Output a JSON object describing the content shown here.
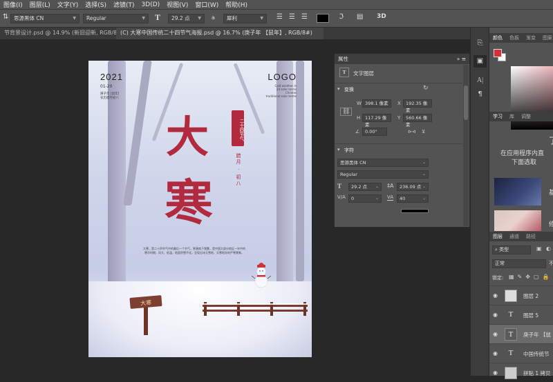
{
  "menubar": {
    "items": [
      "图像(I)",
      "图层(L)",
      "文字(Y)",
      "选择(S)",
      "滤镜(T)",
      "3D(D)",
      "视图(V)",
      "窗口(W)",
      "帮助(H)"
    ]
  },
  "options_bar": {
    "font_family": "思源黑体 CN",
    "font_style": "Regular",
    "font_size": "29.2 点",
    "antialias_label": "a",
    "antialias": "犀利",
    "text_color": "#000000"
  },
  "tabs": [
    {
      "label": "节背景设计.psd @ 14.9% (新旧迎新, RGB/8) *",
      "active": false
    },
    {
      "label": "(C) 大寒中国传统二十四节气海报.psd @ 16.7% (庚子年 【鼠年】, RGB/8#)",
      "active": true
    }
  ],
  "poster": {
    "year": "2021",
    "date": "01-20",
    "sub_lines": [
      "庚子年 [鼠年]",
      "农历腊月初八"
    ],
    "logo": "LOGO",
    "logo_en": [
      "Cold weather in",
      "24 solar terms",
      "Chinese",
      "traditional solar terms"
    ],
    "big_char_1": "大",
    "big_char_2": "寒",
    "seal": "二十四节气",
    "lunar": "腊月 · 初八",
    "paragraph": "大寒，是二十四节气中的最后一个节气，寒潮南下频繁，是中国大部分地区一年中的寒冷时期，风大、低温，地面积雪不化，呈现出冰天雪地、天寒地冻的严寒景象。",
    "sign_text": "大寒"
  },
  "properties": {
    "title": "属性",
    "type_label": "文字图层",
    "transform": {
      "title": "变换",
      "w_label": "W",
      "w": "398.1 像素",
      "x_label": "X",
      "x": "192.35 像素",
      "h_label": "H",
      "h": "117.29 像素",
      "y_label": "Y",
      "y": "560.66 像素",
      "angle": "0.00°"
    },
    "character": {
      "title": "字符",
      "font_family": "思源黑体 CN",
      "font_style": "Regular",
      "size": "29.2 点",
      "leading": "236.09 点",
      "kerning": "0",
      "tracking": "40"
    }
  },
  "right_panel": {
    "color_tabs": [
      "颜色",
      "色板",
      "渐变",
      "图案"
    ],
    "fg_color": "#d7303b",
    "bg_color": "#ffffff",
    "learn_tabs": [
      "学习",
      "库",
      "调整"
    ],
    "learn_title": "了",
    "learn_text": [
      "在应用程序内直",
      "下面选取"
    ],
    "thumb1_label": "基",
    "thumb2_label": "修",
    "layers_tabs": [
      "图层",
      "通道",
      "路径"
    ],
    "kind_label": "类型",
    "blend_mode": "正常",
    "opacity_label": "不",
    "lock_label": "锁定:",
    "layers": [
      {
        "name": "图层 2",
        "type": "image",
        "selected": false
      },
      {
        "name": "图层 5",
        "type": "text",
        "selected": false
      },
      {
        "name": "庚子年 【鼠",
        "type": "text",
        "selected": true
      },
      {
        "name": "中国传统节",
        "type": "text",
        "selected": false
      },
      {
        "name": "拼贴 1 拷贝",
        "type": "image",
        "selected": false
      }
    ]
  }
}
